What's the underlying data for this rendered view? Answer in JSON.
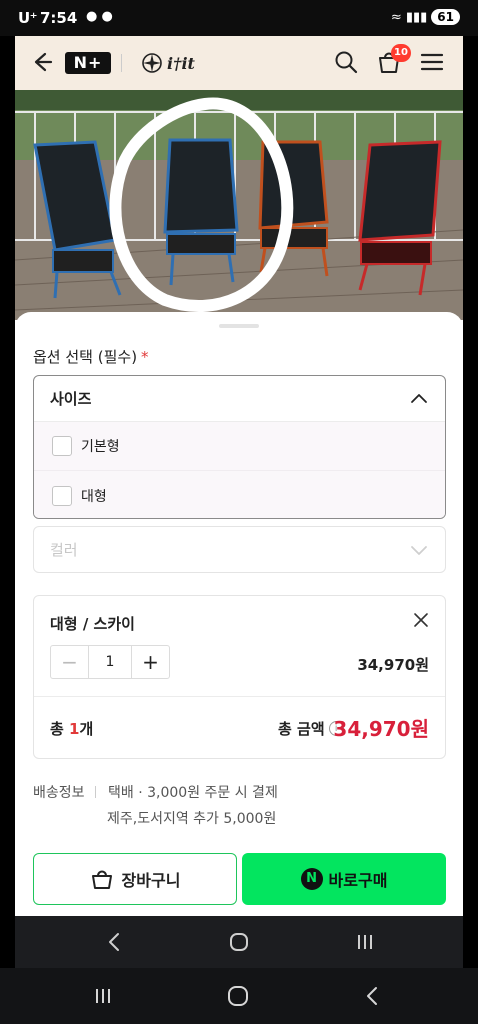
{
  "status_bar": {
    "carrier": "U⁺",
    "time": "7:54",
    "battery": "61"
  },
  "header": {
    "store_badge": "N+",
    "brand_logo_text": "i†it",
    "cart_count": "10",
    "icons": [
      "back-arrow-icon",
      "search-icon",
      "cart-icon",
      "hamburger-menu-icon"
    ]
  },
  "product_image": {
    "description_icons": [
      "camping-chair"
    ]
  },
  "options": {
    "title": "옵션 선택 (필수)",
    "required_mark": "*",
    "size_dropdown": {
      "label": "사이즈",
      "items": [
        "기본형",
        "대형"
      ]
    },
    "color_dropdown": {
      "placeholder": "컬러"
    }
  },
  "selection": {
    "name": "대형 / 스카이",
    "minus": "−",
    "quantity": "1",
    "plus": "+",
    "price": "34,970원",
    "total_count_prefix": "총 ",
    "total_count_number": "1",
    "total_count_suffix": "개",
    "total_label": "총 금액",
    "info_icon": "i",
    "total_amount": "34,970원"
  },
  "shipping": {
    "label": "배송정보",
    "line1": "택배 · 3,000원 주문 시 결제",
    "line2": "제주,도서지역 추가 5,000원"
  },
  "actions": {
    "cart_button": "장바구니",
    "buy_logo": "N",
    "buy_button": "바로구매"
  },
  "colors": {
    "accent_green": "#03e55f",
    "price_red": "#d8203a",
    "header_bg": "#f5ece1",
    "badge_red": "#ff3b2f"
  }
}
